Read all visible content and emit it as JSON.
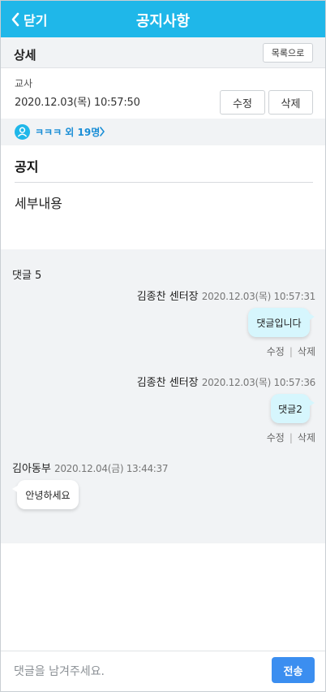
{
  "header": {
    "back_label": "닫기",
    "title": "공지사항"
  },
  "detail_bar": {
    "label": "상세",
    "list_button": "목록으로"
  },
  "post": {
    "author": "교사",
    "date": "2020.12.03(목) 10:57:50",
    "edit_button": "수정",
    "delete_button": "삭제"
  },
  "recipients": {
    "text": "ㅋㅋㅋ 외 19명"
  },
  "notice": {
    "title": "공지",
    "body": "세부내용"
  },
  "comments": {
    "count_label": "댓글 5",
    "items": [
      {
        "author": "김종찬 센터장",
        "timestamp": "2020.12.03(목) 10:57:31",
        "text": "댓글입니다",
        "edit": "수정",
        "delete": "삭제",
        "mine": true
      },
      {
        "author": "김종찬 센터장",
        "timestamp": "2020.12.03(목) 10:57:36",
        "text": "댓글2",
        "edit": "수정",
        "delete": "삭제",
        "mine": true
      },
      {
        "author": "김아동부",
        "timestamp": "2020.12.04(금) 13:44:37",
        "text": "안녕하세요",
        "mine": false
      }
    ],
    "separator": "|"
  },
  "input": {
    "placeholder": "댓글을 남겨주세요.",
    "send_label": "전송"
  },
  "colors": {
    "header": "#1fb7e9",
    "link": "#1a8ed6",
    "send": "#3b8ef0",
    "mine_bubble": "#d6f6fd"
  },
  "icons": {
    "back": "chevron-left-icon",
    "user": "user-icon",
    "more": "chevron-right-icon"
  }
}
